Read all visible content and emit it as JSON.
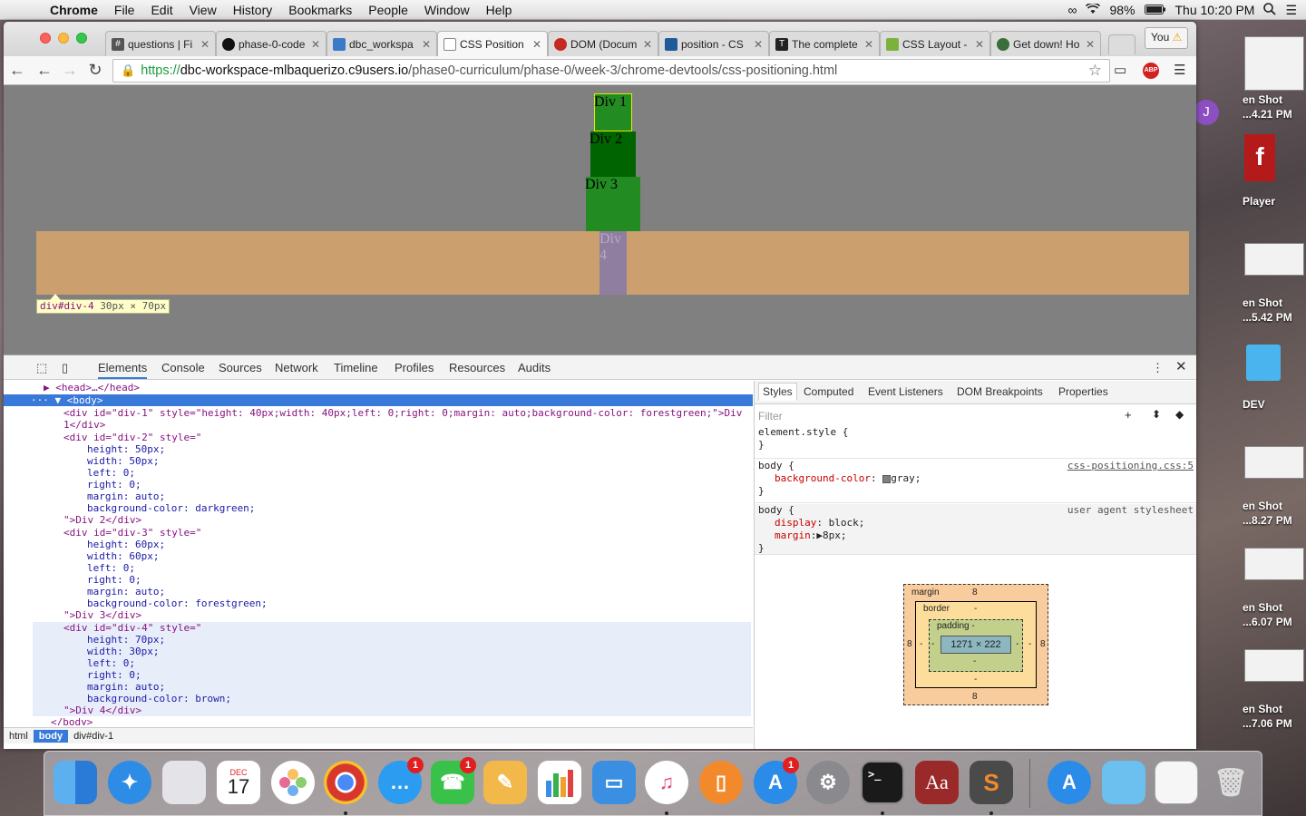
{
  "menubar": {
    "app": "Chrome",
    "items": [
      "File",
      "Edit",
      "View",
      "History",
      "Bookmarks",
      "People",
      "Window",
      "Help"
    ],
    "battery": "98%",
    "clock": "Thu 10:20 PM"
  },
  "desktop": {
    "files": [
      "en Shot\n...4.21 PM",
      "Player",
      "en Shot\n...5.42 PM",
      "DEV",
      "en Shot\n...8.27 PM",
      "en Shot\n...6.07 PM",
      "en Shot\n...7.06 PM"
    ],
    "avatar_letter": "J"
  },
  "tabs": [
    {
      "title": "questions | Fi",
      "icon": "hash-icon",
      "active": false
    },
    {
      "title": "phase-0-code",
      "icon": "github-icon",
      "active": false
    },
    {
      "title": "dbc_workspa",
      "icon": "c9-icon",
      "active": false
    },
    {
      "title": "CSS Position",
      "icon": "page-icon",
      "active": true
    },
    {
      "title": "DOM (Docum",
      "icon": "mdn-icon",
      "active": false
    },
    {
      "title": "position - CS",
      "icon": "mdn-icon",
      "active": false
    },
    {
      "title": "The complete",
      "icon": "t-icon",
      "active": false
    },
    {
      "title": "CSS Layout -",
      "icon": "css-icon",
      "active": false
    },
    {
      "title": "Get down! Ho",
      "icon": "avatar-icon",
      "active": false
    }
  ],
  "profiles": [
    "You",
    "You"
  ],
  "toolbar": {
    "url_scheme": "https://",
    "url_host": "dbc-workspace-mlbaquerizo.c9users.io",
    "url_path": "/phase0-curriculum/phase-0/week-3/chrome-devtools/css-positioning.html",
    "abp_label": "ABP"
  },
  "page": {
    "div1": "Div 1",
    "div2": "Div 2",
    "div3": "Div 3",
    "div4_a": "Div",
    "div4_b": "4",
    "tooltip_id": "div#div-4",
    "tooltip_size": "30px × 70px"
  },
  "devtools": {
    "tabs": [
      "Elements",
      "Console",
      "Sources",
      "Network",
      "Timeline",
      "Profiles",
      "Resources",
      "Audits"
    ],
    "lines": [
      "▶ <head>…</head>",
      "▼ <body>",
      "<div id=\"div-1\" style=\"height: 40px;width: 40px;left: 0;right: 0;margin: auto;background-color: forestgreen;\">Div",
      "1</div>",
      "<div id=\"div-2\" style=\"",
      "height: 50px;",
      "width: 50px;",
      "left: 0;",
      "right: 0;",
      "margin: auto;",
      "background-color: darkgreen;",
      "\">Div 2</div>",
      "<div id=\"div-3\" style=\"",
      "height: 60px;",
      "width: 60px;",
      "left: 0;",
      "right: 0;",
      "margin: auto;",
      "background-color: forestgreen;",
      "\">Div 3</div>",
      "<div id=\"div-4\" style=\"",
      "height: 70px;",
      "width: 30px;",
      "left: 0;",
      "right: 0;",
      "margin: auto;",
      "background-color: brown;",
      "\">Div 4</div>",
      "</body>"
    ],
    "breadcrumbs": [
      "html",
      "body",
      "div#div-1"
    ],
    "styles_tabs": [
      "Styles",
      "Computed",
      "Event Listeners",
      "DOM Breakpoints",
      "Properties"
    ],
    "filter_placeholder": "Filter",
    "rules": {
      "r1_selector": "element.style {",
      "r1_close": "}",
      "r2_selector": "body {",
      "r2_source": "css-positioning.css:5",
      "r2_prop": "background-color",
      "r2_value": "gray;",
      "r2_close": "}",
      "r3_selector": "body {",
      "r3_source": "user agent stylesheet",
      "r3_prop1": "display",
      "r3_val1": "block;",
      "r3_prop2": "margin",
      "r3_val2": "8px;",
      "r3_close": "}"
    },
    "boxmodel": {
      "margin_label": "margin",
      "margin_top": "8",
      "margin_bottom": "8",
      "margin_left": "8",
      "margin_right": "8",
      "border_label": "border",
      "border_val": "-",
      "border_bottom": "-",
      "border_left": "-",
      "border_right": "-",
      "padding_label": "padding -",
      "padding_bottom": "-",
      "padding_left": "-",
      "padding_right": "-",
      "content": "1271 × 222"
    }
  },
  "dock": {
    "calendar_month": "DEC",
    "calendar_day": "17",
    "badges": [
      "1",
      "1",
      "1"
    ],
    "dictionary_label": "Aa"
  },
  "colors": {
    "page_bg": "#808080",
    "forestgreen": "#228b22",
    "darkgreen": "#006400",
    "highlight_band": "#cc9f6f",
    "div4": "#8f7ea0",
    "selection": "#3879d9"
  }
}
